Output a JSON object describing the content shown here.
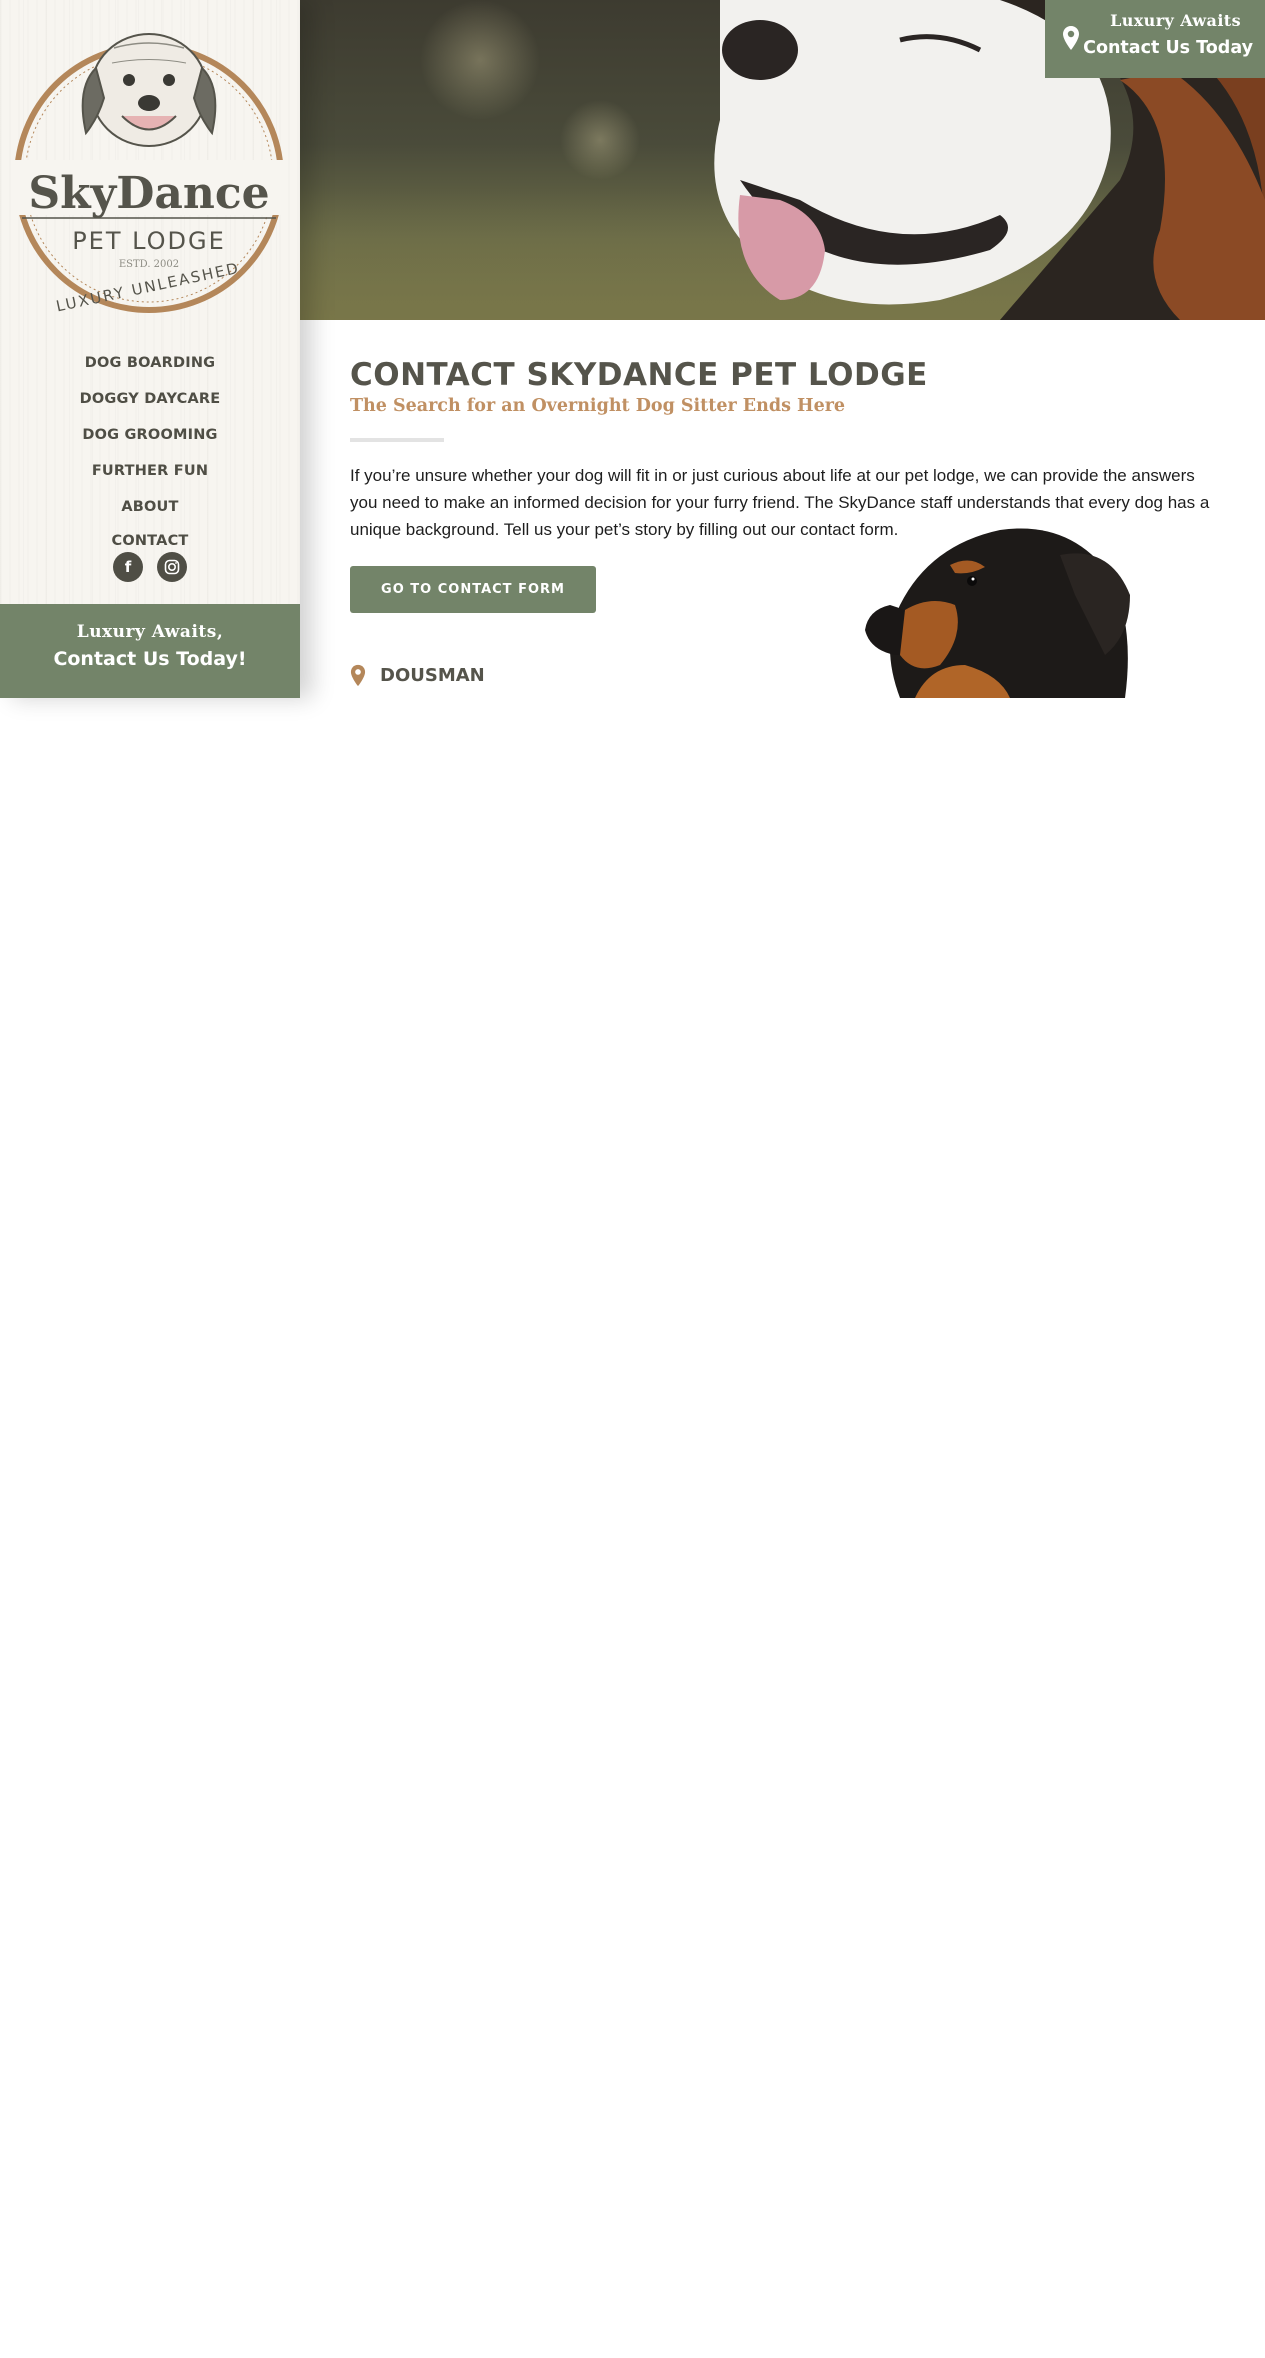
{
  "sidebar": {
    "logo": {
      "brand": "SkyDance",
      "sub": "PET LODGE",
      "est": "ESTD. 2002",
      "tagline": "LUXURY UNLEASHED"
    },
    "nav": [
      {
        "label": "DOG BOARDING"
      },
      {
        "label": "DOGGY DAYCARE"
      },
      {
        "label": "DOG GROOMING"
      },
      {
        "label": "FURTHER FUN"
      },
      {
        "label": "ABOUT"
      },
      {
        "label": "CONTACT"
      }
    ],
    "social": [
      "facebook-icon",
      "instagram-icon"
    ],
    "cta": {
      "line1": "Luxury Awaits,",
      "line2": "Contact Us Today!"
    }
  },
  "header_cta": {
    "line1": "Luxury Awaits",
    "line2": "Contact Us Today"
  },
  "main": {
    "title": "CONTACT SKYDANCE PET LODGE",
    "subtitle": "The Search for an Overnight Dog Sitter Ends Here",
    "intro": "If you’re unsure whether your dog will fit in or just curious about life at our pet lodge, we can provide the answers you need to make an informed decision for your furry friend. The SkyDance staff understands that every dog has a unique background. Tell us your pet’s story by filling out our contact form.",
    "button_label": "GO TO CONTACT FORM",
    "location_label": "DOUSMAN"
  },
  "colors": {
    "accent_green": "#738469",
    "text_dark": "#4f4e45",
    "accent_tan": "#c09063"
  }
}
